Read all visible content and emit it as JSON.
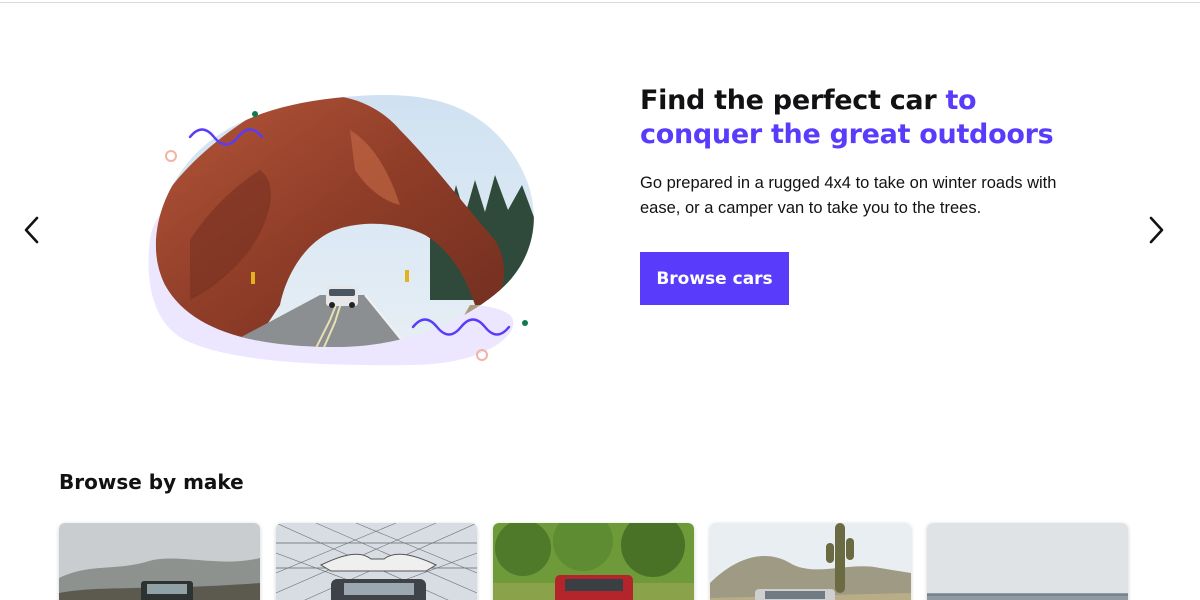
{
  "carousel": {
    "prev_icon": "chevron-left-icon",
    "next_icon": "chevron-right-icon"
  },
  "hero": {
    "title_part1": "Find the perfect car ",
    "title_accent": "to conquer the great outdoors",
    "body": "Go prepared in a rugged 4x4 to take on winter roads with ease, or a camper van to take you to the trees.",
    "cta_label": "Browse cars",
    "image_alt_icon": "red-rock-arch-road-photo",
    "colors": {
      "accent": "#593cfb",
      "blob_lavender": "#ece7ff",
      "decor_coral": "#f3b3a3",
      "decor_green": "#0f7a4f"
    }
  },
  "browse_by_make": {
    "title": "Browse by make",
    "cards": [
      {
        "icon": "jeep-in-mountains-photo"
      },
      {
        "icon": "gullwing-suv-photo"
      },
      {
        "icon": "red-car-in-forest-photo"
      },
      {
        "icon": "car-in-desert-photo"
      },
      {
        "icon": "coastal-road-photo"
      }
    ]
  }
}
